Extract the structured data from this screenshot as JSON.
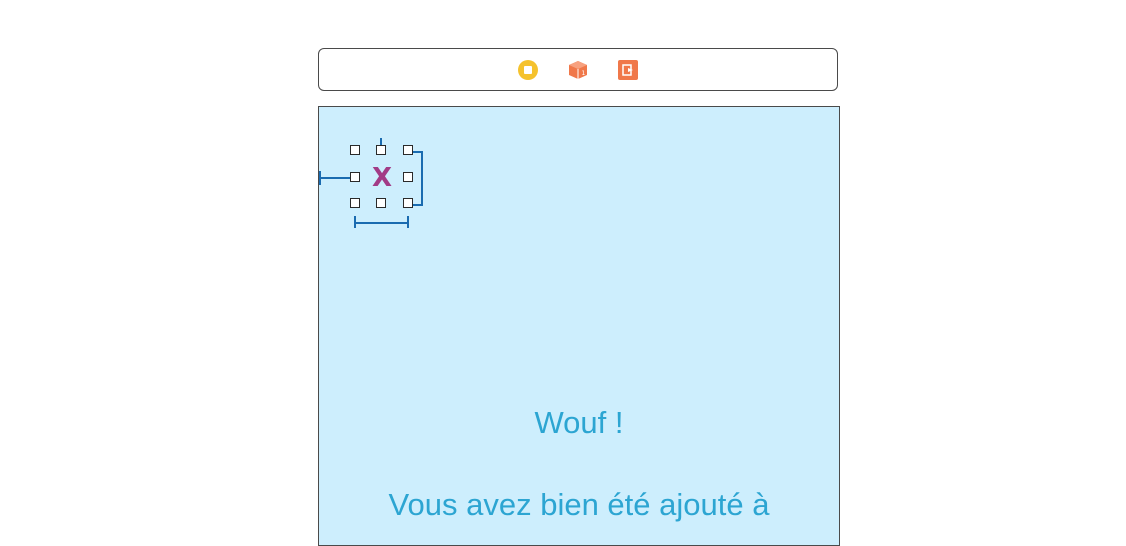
{
  "scene_dock": {
    "icons": [
      "view-controller-icon",
      "first-responder-icon",
      "exit-icon"
    ],
    "colors": {
      "view_controller": "#f5c22d",
      "first_responder": "#f0784a",
      "exit": "#f0784a"
    }
  },
  "canvas": {
    "background": "#cdeefd",
    "close_button": {
      "label": "X",
      "color": "#a23b86"
    },
    "woof_label": "Wouf !",
    "added_label": "Vous avez bien été ajouté à"
  }
}
